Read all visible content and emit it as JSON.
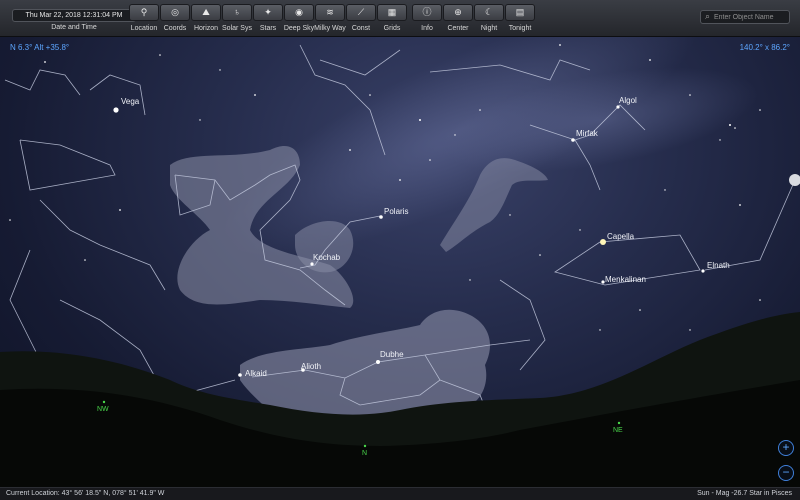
{
  "toolbar": {
    "datetime_value": "Thu Mar 22, 2018   12:31:04 PM",
    "datetime_label": "Date and Time",
    "buttons": [
      {
        "label": "Location",
        "icon": "location-pin-icon"
      },
      {
        "label": "Coords",
        "icon": "coords-icon"
      },
      {
        "label": "Horizon",
        "icon": "horizon-icon"
      },
      {
        "label": "Solar Sys",
        "icon": "planet-icon"
      },
      {
        "label": "Stars",
        "icon": "stars-icon"
      },
      {
        "label": "Deep Sky",
        "icon": "galaxy-icon"
      },
      {
        "label": "Milky Way",
        "icon": "milky-way-icon"
      },
      {
        "label": "Const",
        "icon": "constellation-icon"
      },
      {
        "label": "Grids",
        "icon": "grid-icon"
      },
      {
        "label": "Info",
        "icon": "info-icon"
      },
      {
        "label": "Center",
        "icon": "center-icon"
      },
      {
        "label": "Night",
        "icon": "moon-icon"
      },
      {
        "label": "Tonight",
        "icon": "calendar-icon"
      }
    ],
    "search_placeholder": "Enter Object Name"
  },
  "view": {
    "direction_readout": "N 6.3° Alt +35.8°",
    "fov_readout": "140.2° x 86.2°"
  },
  "star_labels": {
    "vega": "Vega",
    "algol": "Algol",
    "mirfak": "Mirfak",
    "polaris": "Polaris",
    "kochab": "Kochab",
    "capella": "Capella",
    "menkalinan": "Menkalinan",
    "elnath": "Elnath",
    "dubhe": "Dubhe",
    "alioth": "Alioth",
    "alkaid": "Alkaid"
  },
  "compass": {
    "nw": "NW",
    "n": "N",
    "ne": "NE"
  },
  "zoom": {
    "in": "+",
    "out": "−"
  },
  "status": {
    "location": "Current Location: 43° 56' 18.5\" N, 078° 51' 41.9\" W",
    "object_info": "Sun - Mag -26.7 Star in Pisces"
  },
  "colors": {
    "accent_blue": "#5da6ff",
    "compass_green": "#49d64a",
    "toolbar_bg": "#2e3036",
    "sky_deep": "#0e1226"
  }
}
